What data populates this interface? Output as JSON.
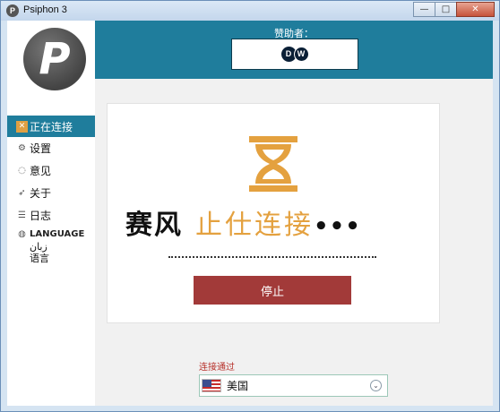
{
  "window": {
    "title": "Psiphon 3",
    "app_icon_letter": "P",
    "minimize_glyph": "—",
    "maximize_glyph": "□",
    "close_glyph": "✕"
  },
  "sidebar": {
    "logo_letter": "P",
    "items": [
      {
        "label": "正在连接",
        "icon": "connect-icon",
        "active": true
      },
      {
        "label": "设置",
        "icon": "gear-icon"
      },
      {
        "label": "意见",
        "icon": "feedback-icon"
      },
      {
        "label": "关于",
        "icon": "rocket-icon"
      },
      {
        "label": "日志",
        "icon": "list-icon"
      }
    ],
    "language": {
      "label": "LANGUAGE",
      "options": [
        "زبان",
        "语言"
      ]
    }
  },
  "sponsor": {
    "label": "赞助者：",
    "logo_text_1": "D",
    "logo_text_2": "W"
  },
  "status": {
    "brand": "赛风",
    "text": "止仕连接",
    "dots": "•••",
    "stop_label": "停止"
  },
  "connect_via": {
    "label": "连接通过",
    "selected_region": "美国",
    "chevron": "⌄"
  },
  "colors": {
    "accent": "#1f7d9c",
    "stop": "#a23a39",
    "hourglass": "#e4a13f",
    "label_red": "#b7312b"
  }
}
